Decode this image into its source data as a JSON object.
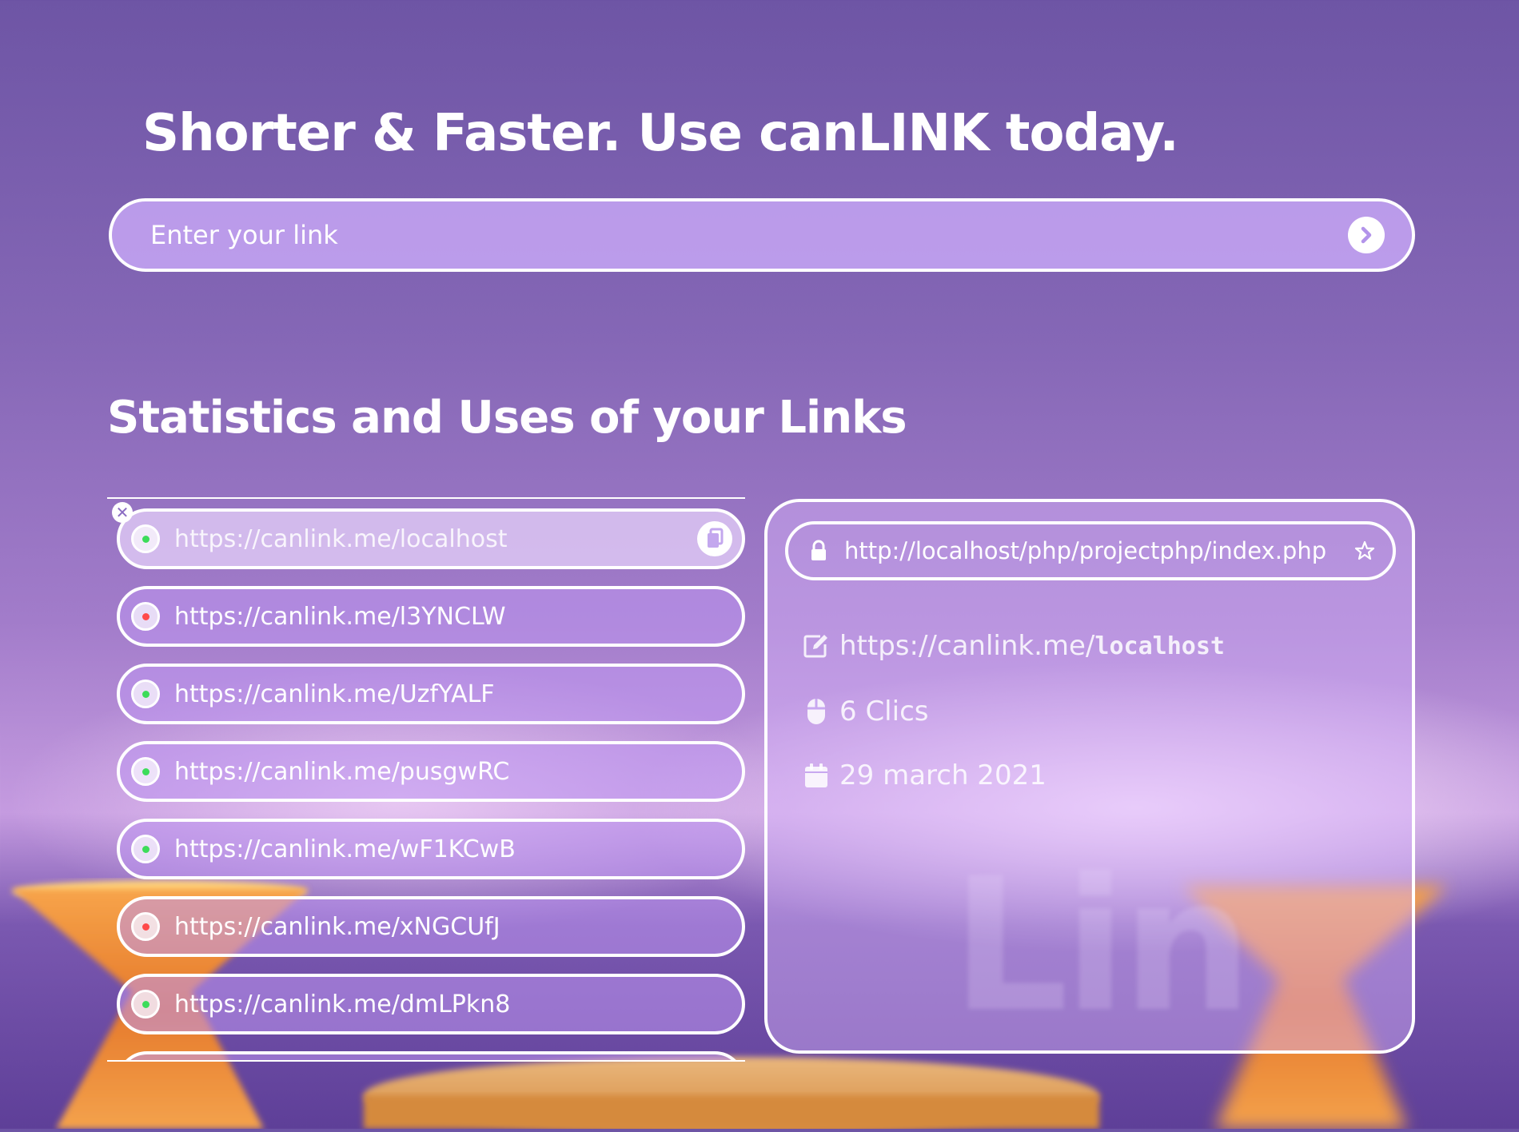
{
  "hero": {
    "title": "Shorter & Faster. Use canLINK today.",
    "input_placeholder": "Enter your link"
  },
  "stats": {
    "title": "Statistics and Uses of your Links",
    "links": [
      {
        "url": "https://canlink.me/localhost",
        "status": "active",
        "status_color": "#3ddc5a"
      },
      {
        "url": "https://canlink.me/l3YNCLW",
        "status": "inactive",
        "status_color": "#ff4a4a"
      },
      {
        "url": "https://canlink.me/UzfYALF",
        "status": "active",
        "status_color": "#3ddc5a"
      },
      {
        "url": "https://canlink.me/pusgwRC",
        "status": "active",
        "status_color": "#3ddc5a"
      },
      {
        "url": "https://canlink.me/wF1KCwB",
        "status": "active",
        "status_color": "#3ddc5a"
      },
      {
        "url": "https://canlink.me/xNGCUfJ",
        "status": "inactive",
        "status_color": "#ff4a4a"
      },
      {
        "url": "https://canlink.me/dmLPkn8",
        "status": "active",
        "status_color": "#3ddc5a"
      }
    ]
  },
  "detail": {
    "original_url": "http://localhost/php/projectphp/index.php",
    "short_prefix": "https://canlink.me/",
    "short_code": "localhost",
    "clicks": "6 Clics",
    "date": "29 march 2021"
  },
  "colors": {
    "accent": "#8a6cc2",
    "active": "#3ddc5a",
    "inactive": "#ff4a4a"
  }
}
